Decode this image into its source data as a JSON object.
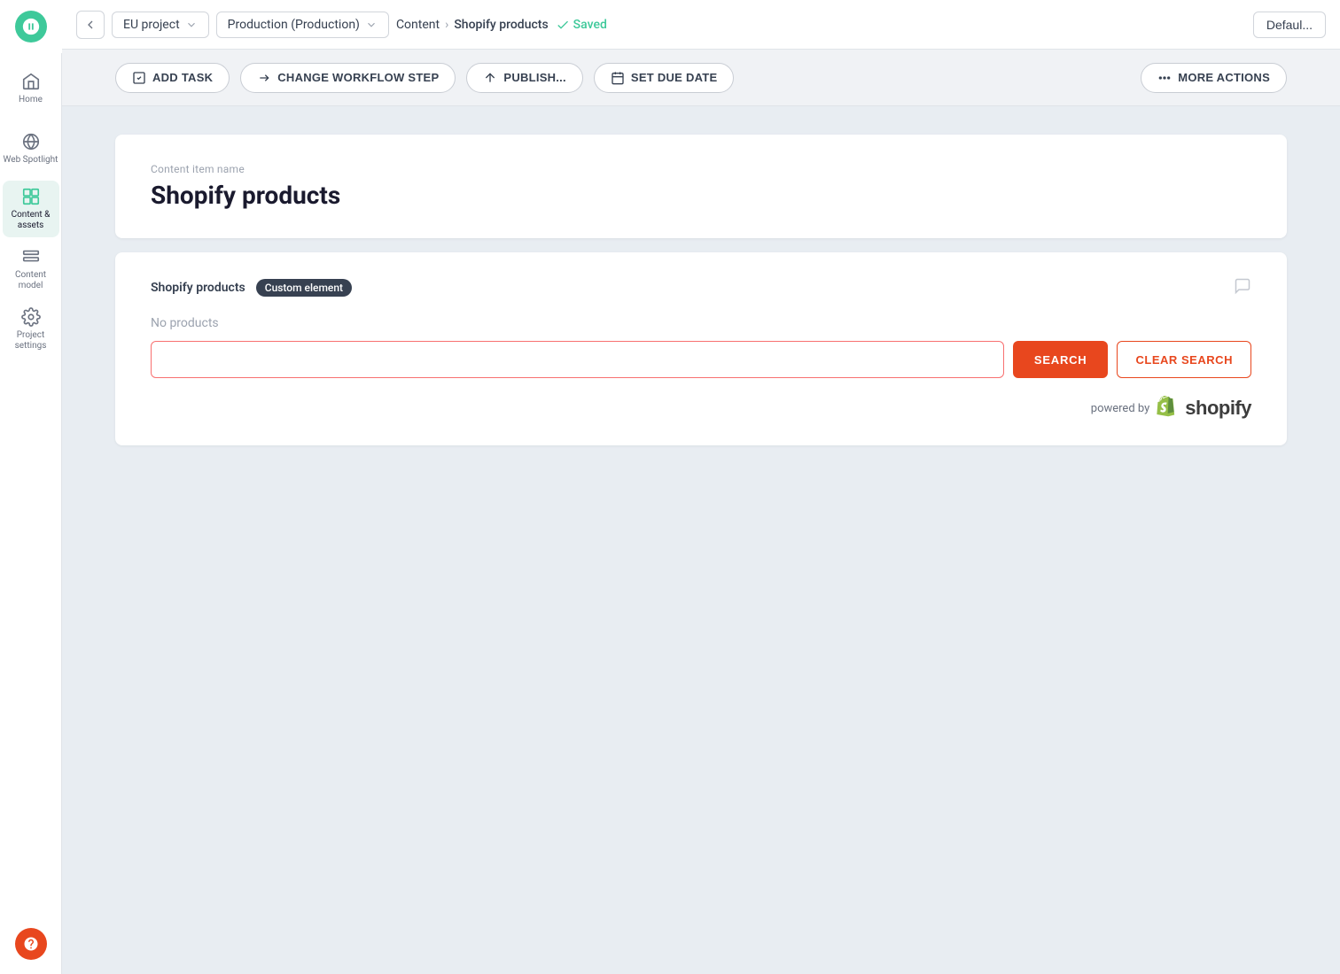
{
  "app": {
    "logo_alt": "Kontent.ai logo"
  },
  "sidebar": {
    "items": [
      {
        "id": "home",
        "label": "Home",
        "active": false
      },
      {
        "id": "web-spotlight",
        "label": "Web Spotlight",
        "active": false
      },
      {
        "id": "content-assets",
        "label": "Content & assets",
        "active": true
      },
      {
        "id": "content-model",
        "label": "Content model",
        "active": false
      },
      {
        "id": "project-settings",
        "label": "Project settings",
        "active": false
      }
    ],
    "support_label": "Support"
  },
  "topbar": {
    "back_label": "Back",
    "project_selector": "EU project",
    "environment_selector": "Production (Production)",
    "breadcrumb": {
      "root": "Content",
      "separator": "›",
      "current": "Shopify products"
    },
    "saved_label": "Saved",
    "default_label": "Defaul..."
  },
  "actionbar": {
    "add_task_label": "ADD TASK",
    "change_workflow_label": "CHANGE WORKFLOW STEP",
    "publish_label": "PUBLISH...",
    "set_due_date_label": "SET DUE DATE",
    "more_actions_label": "MORE ACTIONS"
  },
  "content": {
    "item_name_label": "Content item name",
    "title": "Shopify products",
    "shopify_section": {
      "label": "Shopify products",
      "badge": "Custom element",
      "no_products_label": "No products",
      "search_placeholder": "",
      "search_button_label": "SEARCH",
      "clear_search_label": "CLEAR SEARCH",
      "powered_by_label": "powered by"
    }
  }
}
